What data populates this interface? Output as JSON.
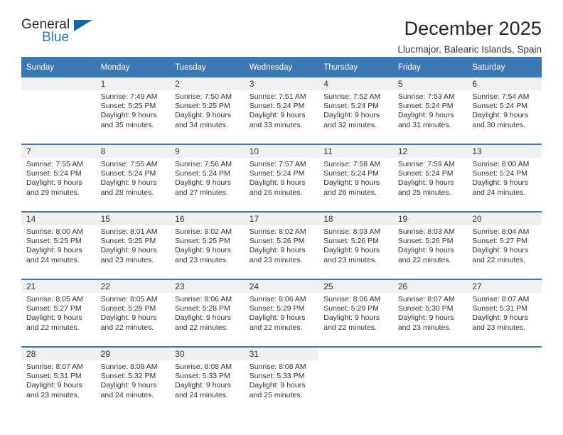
{
  "brand": {
    "name_top": "General",
    "name_bottom": "Blue",
    "accent_color": "#1f7fc4",
    "triangle_color": "#1565a6"
  },
  "header": {
    "title": "December 2025",
    "subtitle": "Llucmajor, Balearic Islands, Spain"
  },
  "theme": {
    "header_blue": "#3c78b4",
    "daynum_band": "#f0f0f0",
    "text": "#333333"
  },
  "weekday_headers": [
    "Sunday",
    "Monday",
    "Tuesday",
    "Wednesday",
    "Thursday",
    "Friday",
    "Saturday"
  ],
  "weeks": [
    [
      {
        "day": "",
        "lines": []
      },
      {
        "day": "1",
        "lines": [
          "Sunrise: 7:49 AM",
          "Sunset: 5:25 PM",
          "Daylight: 9 hours",
          "and 35 minutes."
        ]
      },
      {
        "day": "2",
        "lines": [
          "Sunrise: 7:50 AM",
          "Sunset: 5:25 PM",
          "Daylight: 9 hours",
          "and 34 minutes."
        ]
      },
      {
        "day": "3",
        "lines": [
          "Sunrise: 7:51 AM",
          "Sunset: 5:24 PM",
          "Daylight: 9 hours",
          "and 33 minutes."
        ]
      },
      {
        "day": "4",
        "lines": [
          "Sunrise: 7:52 AM",
          "Sunset: 5:24 PM",
          "Daylight: 9 hours",
          "and 32 minutes."
        ]
      },
      {
        "day": "5",
        "lines": [
          "Sunrise: 7:53 AM",
          "Sunset: 5:24 PM",
          "Daylight: 9 hours",
          "and 31 minutes."
        ]
      },
      {
        "day": "6",
        "lines": [
          "Sunrise: 7:54 AM",
          "Sunset: 5:24 PM",
          "Daylight: 9 hours",
          "and 30 minutes."
        ]
      }
    ],
    [
      {
        "day": "7",
        "lines": [
          "Sunrise: 7:55 AM",
          "Sunset: 5:24 PM",
          "Daylight: 9 hours",
          "and 29 minutes."
        ]
      },
      {
        "day": "8",
        "lines": [
          "Sunrise: 7:55 AM",
          "Sunset: 5:24 PM",
          "Daylight: 9 hours",
          "and 28 minutes."
        ]
      },
      {
        "day": "9",
        "lines": [
          "Sunrise: 7:56 AM",
          "Sunset: 5:24 PM",
          "Daylight: 9 hours",
          "and 27 minutes."
        ]
      },
      {
        "day": "10",
        "lines": [
          "Sunrise: 7:57 AM",
          "Sunset: 5:24 PM",
          "Daylight: 9 hours",
          "and 26 minutes."
        ]
      },
      {
        "day": "11",
        "lines": [
          "Sunrise: 7:58 AM",
          "Sunset: 5:24 PM",
          "Daylight: 9 hours",
          "and 26 minutes."
        ]
      },
      {
        "day": "12",
        "lines": [
          "Sunrise: 7:59 AM",
          "Sunset: 5:24 PM",
          "Daylight: 9 hours",
          "and 25 minutes."
        ]
      },
      {
        "day": "13",
        "lines": [
          "Sunrise: 8:00 AM",
          "Sunset: 5:24 PM",
          "Daylight: 9 hours",
          "and 24 minutes."
        ]
      }
    ],
    [
      {
        "day": "14",
        "lines": [
          "Sunrise: 8:00 AM",
          "Sunset: 5:25 PM",
          "Daylight: 9 hours",
          "and 24 minutes."
        ]
      },
      {
        "day": "15",
        "lines": [
          "Sunrise: 8:01 AM",
          "Sunset: 5:25 PM",
          "Daylight: 9 hours",
          "and 23 minutes."
        ]
      },
      {
        "day": "16",
        "lines": [
          "Sunrise: 8:02 AM",
          "Sunset: 5:25 PM",
          "Daylight: 9 hours",
          "and 23 minutes."
        ]
      },
      {
        "day": "17",
        "lines": [
          "Sunrise: 8:02 AM",
          "Sunset: 5:26 PM",
          "Daylight: 9 hours",
          "and 23 minutes."
        ]
      },
      {
        "day": "18",
        "lines": [
          "Sunrise: 8:03 AM",
          "Sunset: 5:26 PM",
          "Daylight: 9 hours",
          "and 23 minutes."
        ]
      },
      {
        "day": "19",
        "lines": [
          "Sunrise: 8:03 AM",
          "Sunset: 5:26 PM",
          "Daylight: 9 hours",
          "and 22 minutes."
        ]
      },
      {
        "day": "20",
        "lines": [
          "Sunrise: 8:04 AM",
          "Sunset: 5:27 PM",
          "Daylight: 9 hours",
          "and 22 minutes."
        ]
      }
    ],
    [
      {
        "day": "21",
        "lines": [
          "Sunrise: 8:05 AM",
          "Sunset: 5:27 PM",
          "Daylight: 9 hours",
          "and 22 minutes."
        ]
      },
      {
        "day": "22",
        "lines": [
          "Sunrise: 8:05 AM",
          "Sunset: 5:28 PM",
          "Daylight: 9 hours",
          "and 22 minutes."
        ]
      },
      {
        "day": "23",
        "lines": [
          "Sunrise: 8:06 AM",
          "Sunset: 5:28 PM",
          "Daylight: 9 hours",
          "and 22 minutes."
        ]
      },
      {
        "day": "24",
        "lines": [
          "Sunrise: 8:06 AM",
          "Sunset: 5:29 PM",
          "Daylight: 9 hours",
          "and 22 minutes."
        ]
      },
      {
        "day": "25",
        "lines": [
          "Sunrise: 8:06 AM",
          "Sunset: 5:29 PM",
          "Daylight: 9 hours",
          "and 22 minutes."
        ]
      },
      {
        "day": "26",
        "lines": [
          "Sunrise: 8:07 AM",
          "Sunset: 5:30 PM",
          "Daylight: 9 hours",
          "and 23 minutes."
        ]
      },
      {
        "day": "27",
        "lines": [
          "Sunrise: 8:07 AM",
          "Sunset: 5:31 PM",
          "Daylight: 9 hours",
          "and 23 minutes."
        ]
      }
    ],
    [
      {
        "day": "28",
        "lines": [
          "Sunrise: 8:07 AM",
          "Sunset: 5:31 PM",
          "Daylight: 9 hours",
          "and 23 minutes."
        ]
      },
      {
        "day": "29",
        "lines": [
          "Sunrise: 8:08 AM",
          "Sunset: 5:32 PM",
          "Daylight: 9 hours",
          "and 24 minutes."
        ]
      },
      {
        "day": "30",
        "lines": [
          "Sunrise: 8:08 AM",
          "Sunset: 5:33 PM",
          "Daylight: 9 hours",
          "and 24 minutes."
        ]
      },
      {
        "day": "31",
        "lines": [
          "Sunrise: 8:08 AM",
          "Sunset: 5:33 PM",
          "Daylight: 9 hours",
          "and 25 minutes."
        ]
      },
      {
        "day": "",
        "lines": []
      },
      {
        "day": "",
        "lines": []
      },
      {
        "day": "",
        "lines": []
      }
    ]
  ]
}
